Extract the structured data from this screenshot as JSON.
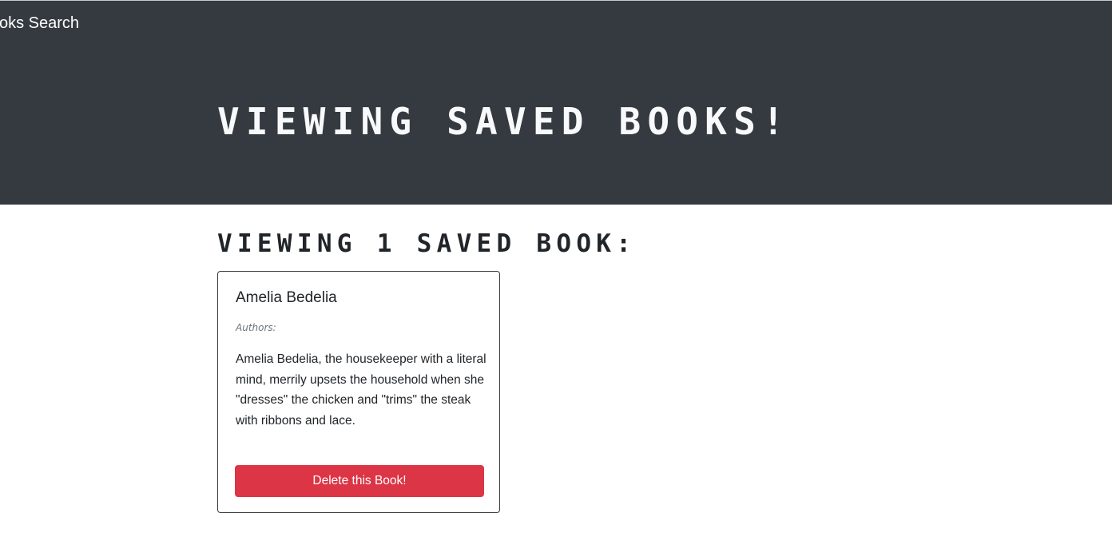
{
  "navbar": {
    "brand": "oks Search"
  },
  "hero": {
    "title": "VIEWING SAVED BOOKS!"
  },
  "saved": {
    "heading": "VIEWING 1 SAVED BOOK:",
    "books": [
      {
        "title": "Amelia Bedelia",
        "authors_label": "Authors:",
        "description": "Amelia Bedelia, the housekeeper with a literal mind, merrily upsets the household when she \"dresses\" the chicken and \"trims\" the steak with ribbons and lace.",
        "delete_label": "Delete this Book!"
      }
    ]
  },
  "colors": {
    "header_bg": "#343a40",
    "danger": "#dc3545"
  }
}
